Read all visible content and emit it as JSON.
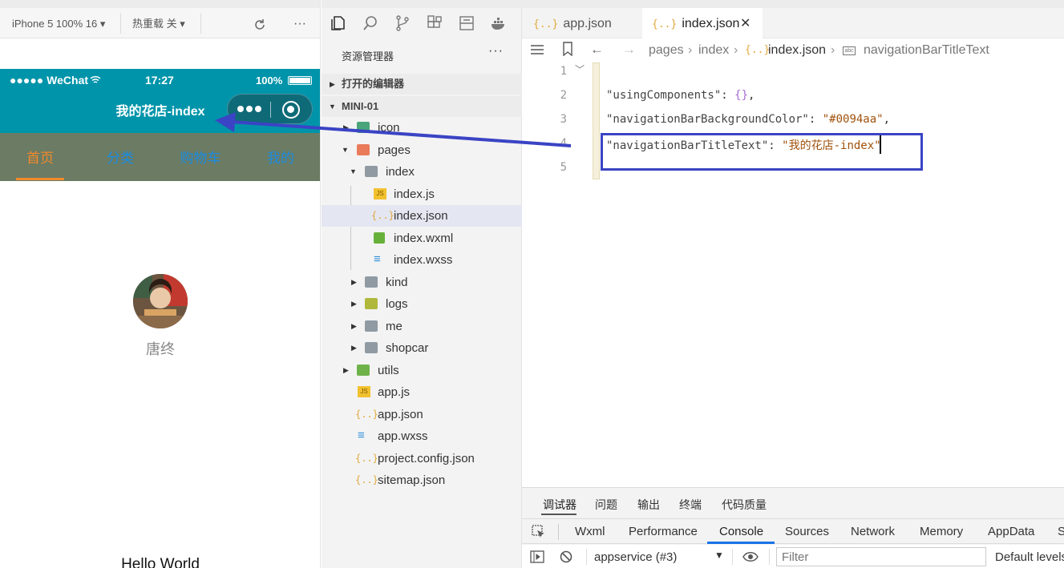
{
  "simulator": {
    "device": "iPhone 5 100% 16 ▾",
    "hotreload": "热重载 关 ▾",
    "more": "···",
    "status": {
      "signal": "●●●●● WeChat",
      "time": "17:27",
      "battery": "100%"
    },
    "nav_title": "我的花店-index",
    "tabs": [
      "首页",
      "分类",
      "购物车",
      "我的"
    ],
    "username": "唐终",
    "hello": "Hello World"
  },
  "explorer": {
    "title": "资源管理器",
    "more": "···",
    "open_editors": "打开的编辑器",
    "project": "MINI-01",
    "tree": [
      "icon",
      "pages",
      "index",
      "index.js",
      "index.json",
      "index.wxml",
      "index.wxss",
      "kind",
      "logs",
      "me",
      "shopcar",
      "utils",
      "app.js",
      "app.json",
      "app.wxss",
      "project.config.json",
      "sitemap.json"
    ]
  },
  "editor": {
    "tabs": [
      {
        "label": "app.json"
      },
      {
        "label": "index.json"
      }
    ],
    "breadcrumb": [
      "pages",
      "index",
      "index.json",
      "navigationBarTitleText"
    ],
    "lines": [
      "1",
      "2",
      "3",
      "4",
      "5"
    ],
    "code": {
      "open": "{",
      "k1": "\"usingComponents\"",
      "v1": "{}",
      "k2": "\"navigationBarBackgroundColor\"",
      "v2": "\"#0094aa\"",
      "k3": "\"navigationBarTitleText\"",
      "v3": "\"我的花店-index\"",
      "colon": ": ",
      "comma": ","
    }
  },
  "devtools": {
    "top_tabs": [
      "调试器",
      "问题",
      "输出",
      "终端",
      "代码质量"
    ],
    "tabs": [
      "Wxml",
      "Performance",
      "Console",
      "Sources",
      "Network",
      "Memory",
      "AppData",
      "S"
    ],
    "context": "appservice (#3)",
    "filter_placeholder": "Filter",
    "levels": "Default levels"
  },
  "colors": {
    "nav": "#0094aa",
    "highlight_box": "#3a44c4",
    "arrow": "#3a44c4",
    "tab_active": "#f28a2a"
  }
}
